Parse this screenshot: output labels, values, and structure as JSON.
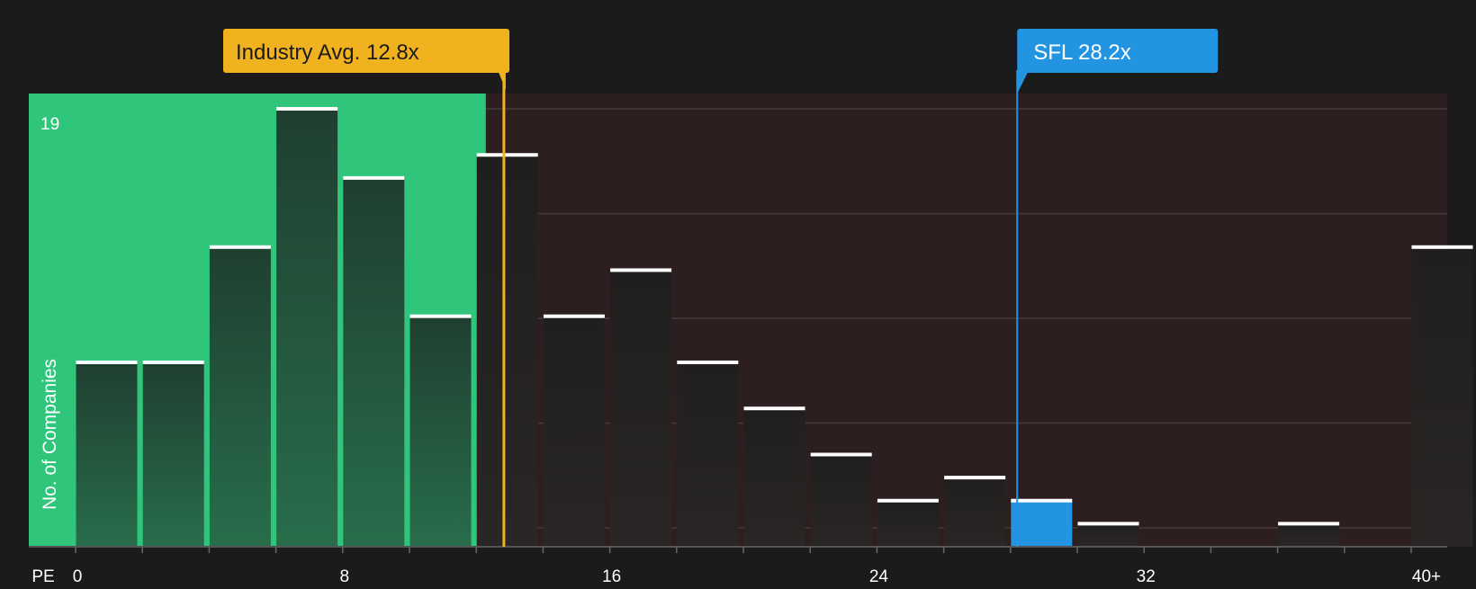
{
  "chart_data": {
    "type": "bar",
    "xlabel": "PE",
    "ylabel": "No. of Companies",
    "x_ticks": [
      "0",
      "8",
      "16",
      "24",
      "32",
      "40+"
    ],
    "y_max_label": "19",
    "ylim": [
      0,
      19
    ],
    "grid": true,
    "bin_width": 2,
    "bars": [
      {
        "x_start": 0,
        "value": 8
      },
      {
        "x_start": 2,
        "value": 8
      },
      {
        "x_start": 4,
        "value": 13
      },
      {
        "x_start": 6,
        "value": 19
      },
      {
        "x_start": 8,
        "value": 16
      },
      {
        "x_start": 10,
        "value": 10
      },
      {
        "x_start": 12,
        "value": 17
      },
      {
        "x_start": 14,
        "value": 10
      },
      {
        "x_start": 16,
        "value": 12
      },
      {
        "x_start": 18,
        "value": 8
      },
      {
        "x_start": 20,
        "value": 6
      },
      {
        "x_start": 22,
        "value": 4
      },
      {
        "x_start": 24,
        "value": 2
      },
      {
        "x_start": 26,
        "value": 3
      },
      {
        "x_start": 28,
        "value": 2,
        "highlight": true
      },
      {
        "x_start": 30,
        "value": 1
      },
      {
        "x_start": 32,
        "value": 0
      },
      {
        "x_start": 34,
        "value": 0
      },
      {
        "x_start": 36,
        "value": 1
      },
      {
        "x_start": 38,
        "value": 0
      },
      {
        "x_start": 40,
        "value": 13
      }
    ],
    "industry_avg": {
      "label": "Industry Avg. 12.8x",
      "value": 12.8
    },
    "company": {
      "label": "SFL 28.2x",
      "value": 28.2
    },
    "colors": {
      "background": "#1b1b1b",
      "undervalued_zone": "#2fc67c",
      "overvalued_zone": "#2d1f1f",
      "industry_marker": "#f0b21e",
      "company_marker": "#2394e2",
      "bar_top": "#ffffff"
    }
  }
}
